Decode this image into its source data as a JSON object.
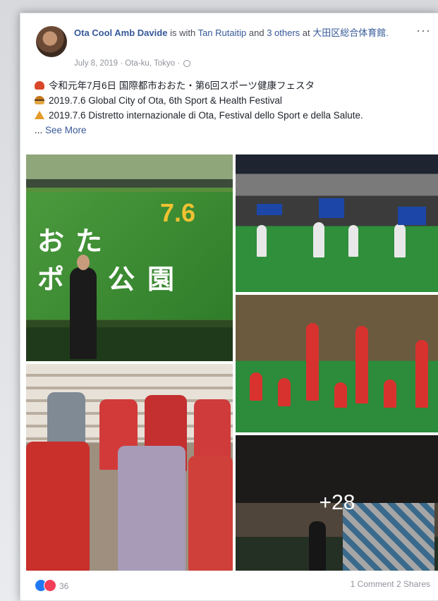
{
  "post": {
    "author": "Ota Cool Amb Davide",
    "with_text": "is with",
    "tagged_person": "Tan Rutaitip",
    "and_text": "and",
    "others_link": "3 others",
    "at_text": "at",
    "place": "大田区総合体育館.",
    "date": "July 8, 2019",
    "location": "Ota-ku, Tokyo",
    "sep": "·",
    "more_menu": "···"
  },
  "body": {
    "line1": "令和元年7月6日 国際都市おおた・第6回スポーツ健康フェスタ",
    "line2": "2019.7.6 Global City of Ota, 6th Sport & Health Festival",
    "line3": "2019.7.6 Distretto internazionale di Ota, Festival dello Sport e della Salute.",
    "ellipsis": "...",
    "see_more": "See More"
  },
  "photo1": {
    "char1": "お",
    "char2": "た",
    "char3": "ポ",
    "char4": "公",
    "char5": "園",
    "date_text": "7.6"
  },
  "gallery": {
    "more_count": "+28"
  },
  "footer": {
    "reaction_count": "36",
    "comments": "1 Comment",
    "shares": "2 Shares"
  },
  "icons": {
    "like": "like-icon",
    "love": "love-icon",
    "globe": "globe-icon"
  }
}
